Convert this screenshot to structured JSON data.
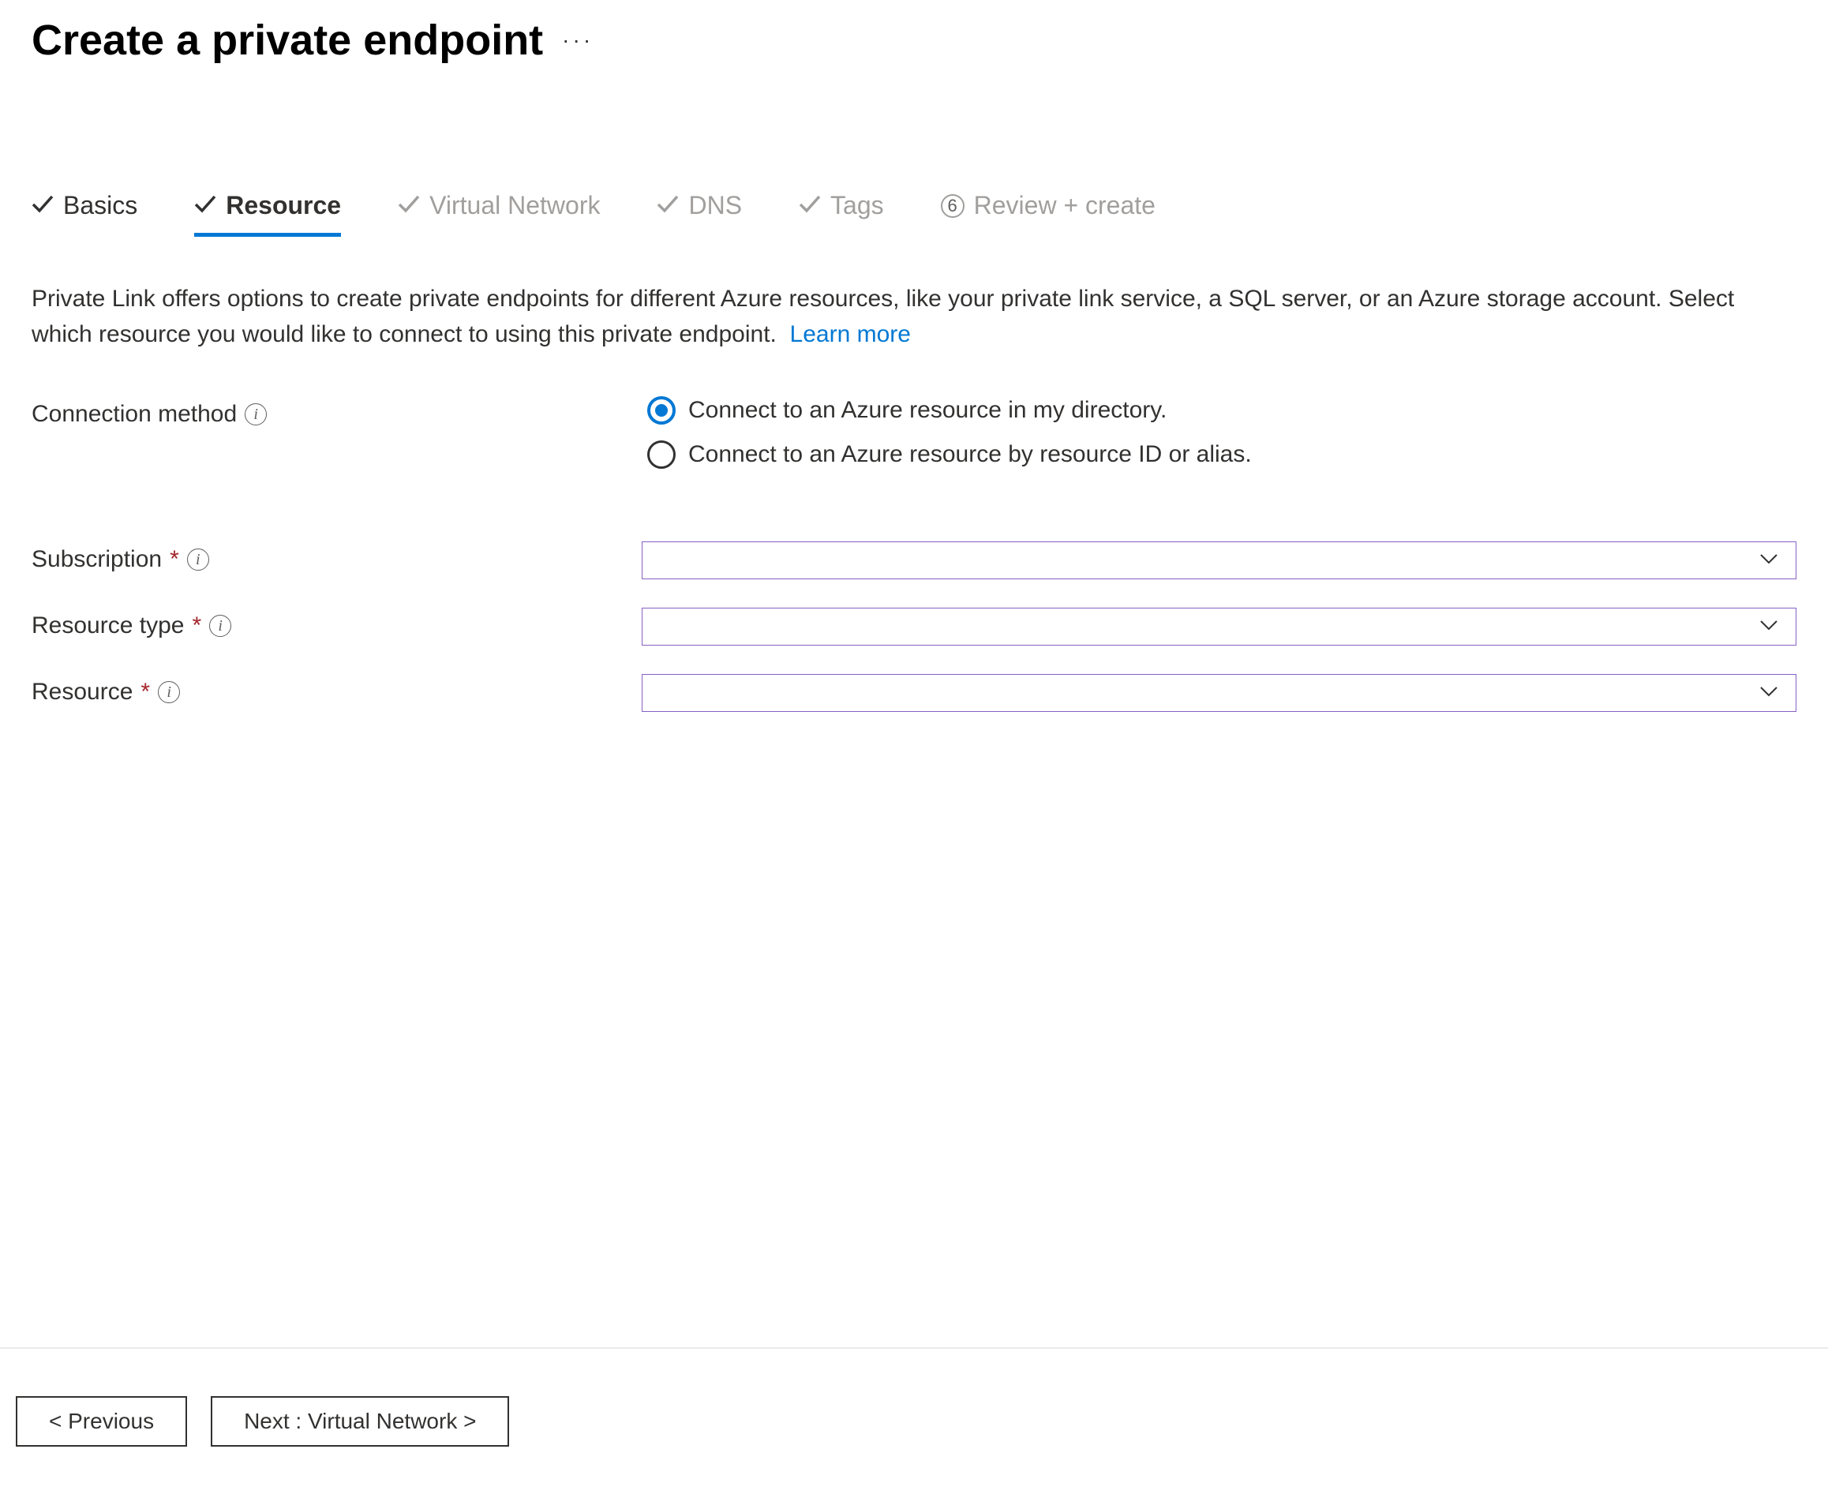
{
  "page": {
    "title": "Create a private endpoint"
  },
  "tabs": {
    "basics": {
      "label": "Basics"
    },
    "resource": {
      "label": "Resource"
    },
    "virtual_network": {
      "label": "Virtual Network"
    },
    "dns": {
      "label": "DNS"
    },
    "tags": {
      "label": "Tags"
    },
    "review": {
      "label": "Review + create",
      "step": "6"
    }
  },
  "description": {
    "text": "Private Link offers options to create private endpoints for different Azure resources, like your private link service, a SQL server, or an Azure storage account. Select which resource you would like to connect to using this private endpoint.",
    "learn_more": "Learn more"
  },
  "form": {
    "connection_method": {
      "label": "Connection method",
      "option1": "Connect to an Azure resource in my directory.",
      "option2": "Connect to an Azure resource by resource ID or alias.",
      "selected": "option1"
    },
    "subscription": {
      "label": "Subscription",
      "value": ""
    },
    "resource_type": {
      "label": "Resource type",
      "value": ""
    },
    "resource": {
      "label": "Resource",
      "value": ""
    }
  },
  "footer": {
    "previous": "< Previous",
    "next": "Next : Virtual Network >"
  }
}
